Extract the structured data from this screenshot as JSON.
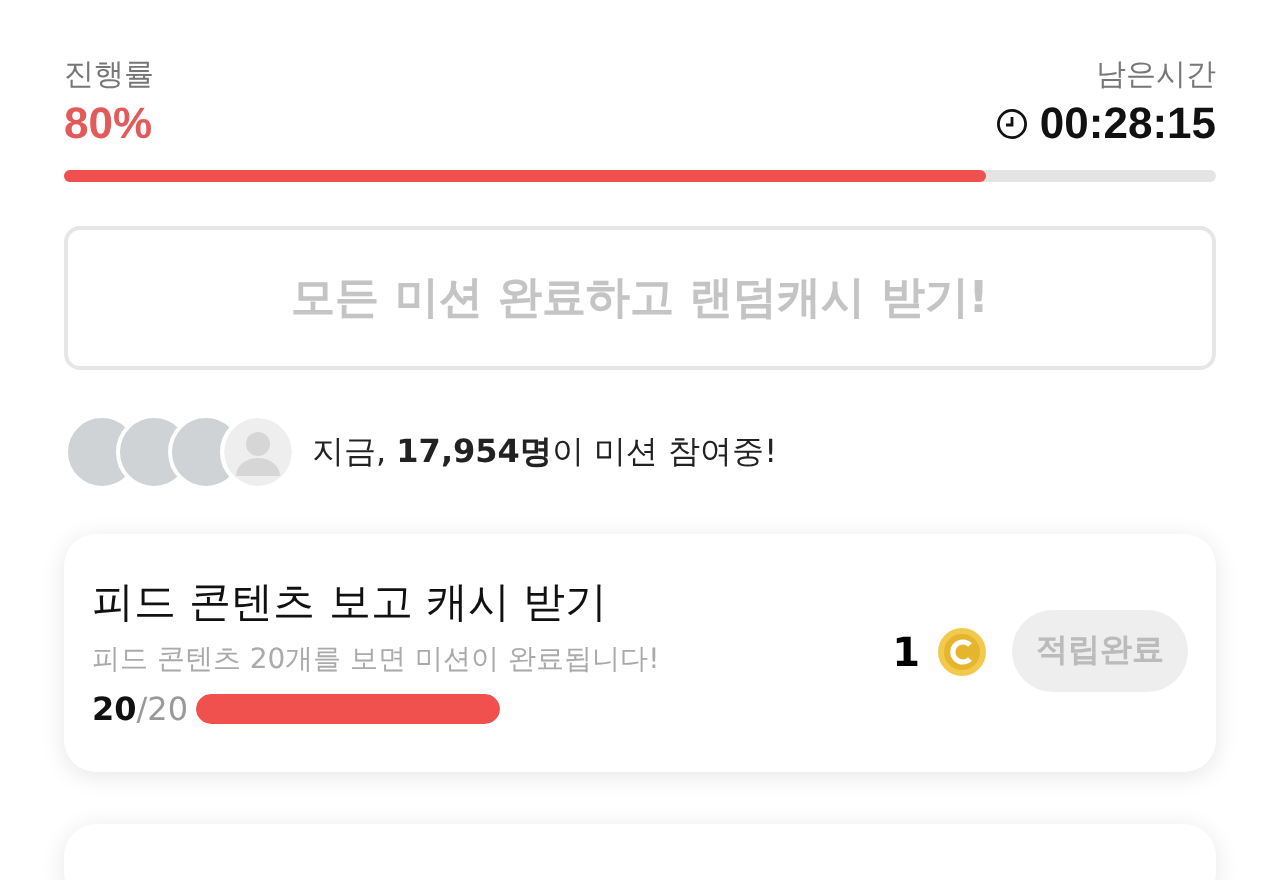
{
  "progress": {
    "label": "진행률",
    "percent": "80%",
    "level": 0.8
  },
  "timer": {
    "label": "남은시간",
    "time": "00:28:15"
  },
  "reward_button": {
    "label": "모든 미션 완료하고 랜덤캐시 받기!",
    "disabled": true
  },
  "participants": {
    "avatars": [
      {
        "kind": "photo"
      },
      {
        "kind": "photo"
      },
      {
        "kind": "photo"
      },
      {
        "kind": "silhouette"
      }
    ],
    "text": "지금, **17,954명**이 미션 참여중!"
  },
  "missions": [
    {
      "title": "피드 콘텐츠 보고 캐시 받기",
      "description": "피드 콘텐츠 20개를 보면 미션이 완료됩니다!",
      "done": "20",
      "total": "/20",
      "level": 1,
      "reward": "1",
      "button": "적립완료",
      "completed": true
    }
  ]
}
